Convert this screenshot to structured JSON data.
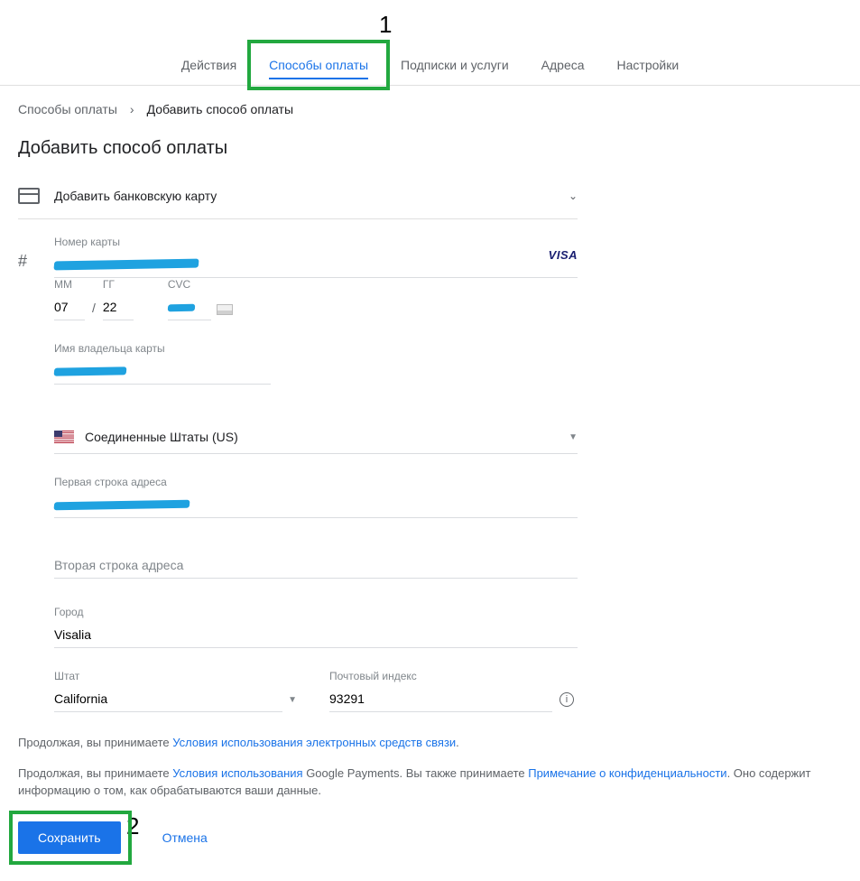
{
  "callouts": {
    "one": "1",
    "two": "2"
  },
  "nav": {
    "tabs": [
      {
        "label": "Действия"
      },
      {
        "label": "Способы оплаты"
      },
      {
        "label": "Подписки и услуги"
      },
      {
        "label": "Адреса"
      },
      {
        "label": "Настройки"
      }
    ],
    "active_index": 1
  },
  "breadcrumb": {
    "root": "Способы оплаты",
    "current": "Добавить способ оплаты"
  },
  "page_title": "Добавить способ оплаты",
  "payment_method": {
    "type_label": "Добавить банковскую карту",
    "card_brand": "VISA",
    "hash": "#",
    "card_number_label": "Номер карты",
    "card_number_value_redacted": true,
    "mm_label": "ММ",
    "mm_value": "07",
    "slash": "/",
    "yy_label": "ГГ",
    "yy_value": "22",
    "cvc_label": "CVC",
    "cvc_value_redacted": true,
    "holder_label": "Имя владельца карты",
    "holder_value_redacted": true
  },
  "address": {
    "country_label": "Соединенные Штаты (US)",
    "line1_label": "Первая строка адреса",
    "line1_value_redacted": true,
    "line2_placeholder": "Вторая строка адреса",
    "city_label": "Город",
    "city_value": "Visalia",
    "state_label": "Штат",
    "state_value": "California",
    "zip_label": "Почтовый индекс",
    "zip_value": "93291"
  },
  "legal": {
    "line1_pre": "Продолжая, вы принимаете ",
    "line1_link": "Условия использования электронных средств связи",
    "line1_post": ".",
    "line2_pre": "Продолжая, вы принимаете ",
    "line2_link1": "Условия использования",
    "line2_mid": " Google Payments. Вы также принимаете ",
    "line2_link2": "Примечание о конфиденциальности",
    "line2_post": ". Оно содержит информацию о том, как обрабатываются ваши данные."
  },
  "actions": {
    "save": "Сохранить",
    "cancel": "Отмена"
  }
}
